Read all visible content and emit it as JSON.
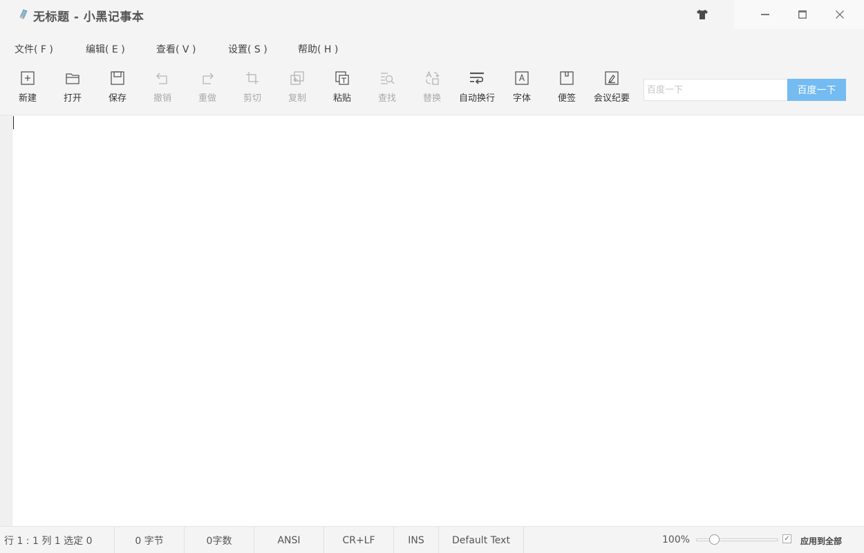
{
  "window": {
    "title": "无标题 - 小黑记事本",
    "app_icon": "notebook-icon",
    "skin_icon": "tshirt-icon",
    "controls": [
      "minimize-icon",
      "maximize-icon",
      "close-icon"
    ]
  },
  "menu": [
    {
      "label": "文件( F )"
    },
    {
      "label": "编辑( E )"
    },
    {
      "label": "查看( V )"
    },
    {
      "label": "设置( S )"
    },
    {
      "label": "帮助( H )"
    }
  ],
  "toolbar": [
    {
      "label": "新建",
      "icon": "new-file-icon",
      "enabled": true
    },
    {
      "label": "打开",
      "icon": "folder-open-icon",
      "enabled": true
    },
    {
      "label": "保存",
      "icon": "save-icon",
      "enabled": true
    },
    {
      "label": "撤销",
      "icon": "undo-icon",
      "enabled": false
    },
    {
      "label": "重做",
      "icon": "redo-icon",
      "enabled": false
    },
    {
      "label": "剪切",
      "icon": "cut-icon",
      "enabled": false
    },
    {
      "label": "复制",
      "icon": "copy-icon",
      "enabled": false
    },
    {
      "label": "粘贴",
      "icon": "paste-icon",
      "enabled": true
    },
    {
      "label": "查找",
      "icon": "find-icon",
      "enabled": false
    },
    {
      "label": "替换",
      "icon": "replace-icon",
      "enabled": false
    },
    {
      "label": "自动换行",
      "icon": "word-wrap-icon",
      "enabled": true
    },
    {
      "label": "字体",
      "icon": "font-icon",
      "enabled": true
    },
    {
      "label": "便签",
      "icon": "sticky-note-icon",
      "enabled": true
    },
    {
      "label": "会议纪要",
      "icon": "meeting-notes-icon",
      "enabled": true
    }
  ],
  "search": {
    "placeholder": "百度一下",
    "value": "",
    "button_label": "百度一下",
    "button_color": "#74bbf2"
  },
  "editor": {
    "content": ""
  },
  "status": {
    "position": "行 1 : 1   列 1   选定 0",
    "bytes": "0 字节",
    "chars": "0字数",
    "encoding": "ANSI",
    "line_ending": "CR+LF",
    "insert_mode": "INS",
    "syntax": "Default Text",
    "zoom": "100%",
    "zoom_level": 0.2,
    "apply_all_label": "应用到全部",
    "apply_all_checked": true
  }
}
